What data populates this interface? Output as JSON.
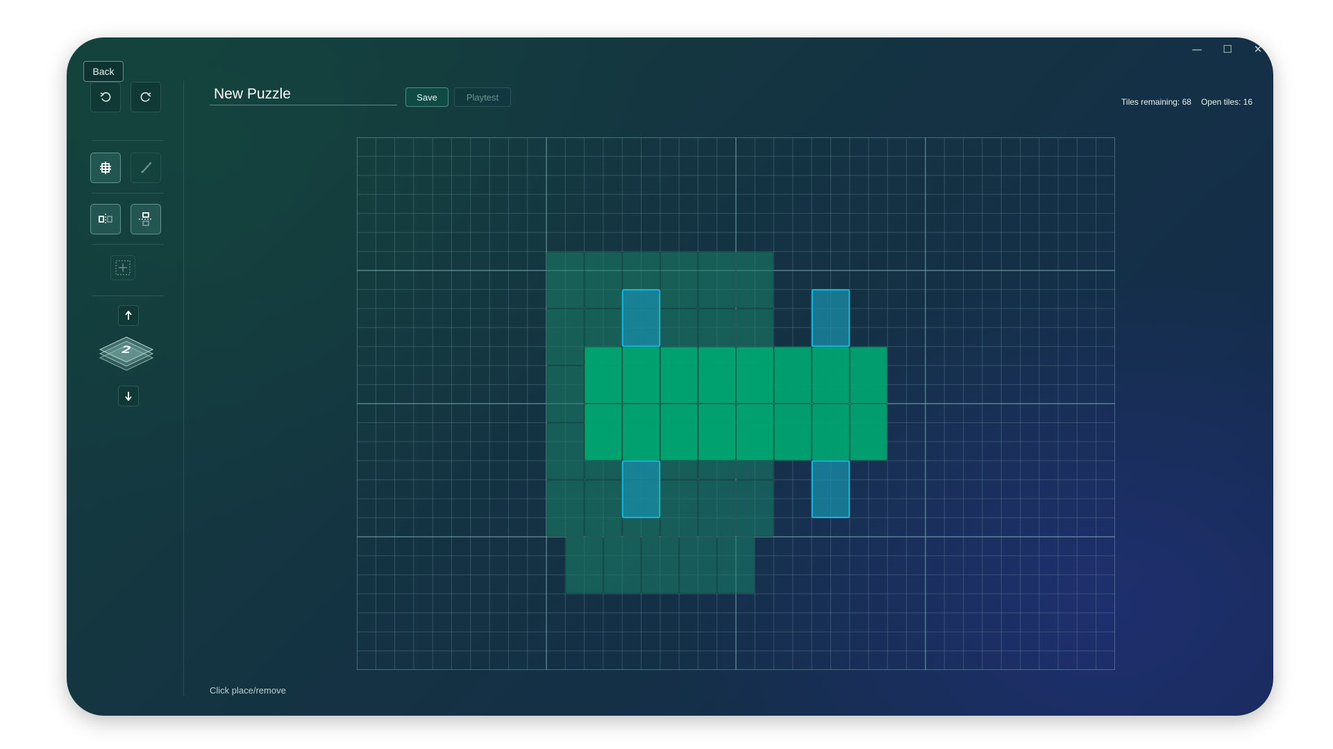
{
  "window": {
    "minimize_glyph": "—",
    "maximize_glyph": "☐",
    "close_glyph": "✕"
  },
  "header": {
    "back_label": "Back",
    "puzzle_title": "New Puzzle",
    "save_label": "Save",
    "playtest_label": "Playtest",
    "tiles_remaining_label": "Tiles remaining: 68",
    "open_tiles_label": "Open tiles: 16"
  },
  "sidebar": {
    "tools": [
      "undo-icon",
      "redo-icon",
      "grid-place-icon",
      "paint-brush-icon",
      "mirror-horizontal-icon",
      "mirror-vertical-icon",
      "move-icon"
    ],
    "layer": {
      "current": "2",
      "up_icon": "arrow-up-icon",
      "down_icon": "arrow-down-icon"
    }
  },
  "footer": {
    "hint": "Click place/remove"
  },
  "board": {
    "grid_columns": 40,
    "grid_rows": 28,
    "layers": [
      {
        "name": "base",
        "color": "#19826a",
        "tiles": [
          [
            10,
            6
          ],
          [
            12,
            6
          ],
          [
            14,
            6
          ],
          [
            16,
            6
          ],
          [
            18,
            6
          ],
          [
            20,
            6
          ],
          [
            10,
            9
          ],
          [
            12,
            9
          ],
          [
            14,
            9
          ],
          [
            16,
            9
          ],
          [
            18,
            9
          ],
          [
            20,
            9
          ],
          [
            10,
            12
          ],
          [
            12,
            12
          ],
          [
            14,
            12
          ],
          [
            16,
            12
          ],
          [
            18,
            12
          ],
          [
            20,
            12
          ],
          [
            10,
            15
          ],
          [
            12,
            15
          ],
          [
            14,
            15
          ],
          [
            16,
            15
          ],
          [
            18,
            15
          ],
          [
            20,
            15
          ],
          [
            10,
            18
          ],
          [
            12,
            18
          ],
          [
            14,
            18
          ],
          [
            16,
            18
          ],
          [
            18,
            18
          ],
          [
            20,
            18
          ],
          [
            11,
            21
          ],
          [
            13,
            21
          ],
          [
            15,
            21
          ],
          [
            17,
            21
          ],
          [
            19,
            21
          ]
        ]
      },
      {
        "name": "middle",
        "color": "#00a371",
        "tiles": [
          [
            12,
            11
          ],
          [
            14,
            11
          ],
          [
            16,
            11
          ],
          [
            18,
            11
          ],
          [
            20,
            11
          ],
          [
            22,
            11
          ],
          [
            24,
            11
          ],
          [
            26,
            11
          ],
          [
            12,
            14
          ],
          [
            14,
            14
          ],
          [
            16,
            14
          ],
          [
            18,
            14
          ],
          [
            20,
            14
          ],
          [
            22,
            14
          ],
          [
            24,
            14
          ],
          [
            26,
            14
          ]
        ]
      },
      {
        "name": "open",
        "color": "#1a8fa8",
        "tiles": [
          [
            14,
            8
          ],
          [
            24,
            8
          ],
          [
            14,
            17
          ],
          [
            24,
            17
          ]
        ]
      }
    ],
    "accent_colors": {
      "open_tile_border": "#19b8dc",
      "tile_border": "#2fbf8f",
      "grid_line": "#6f9fa5"
    }
  }
}
